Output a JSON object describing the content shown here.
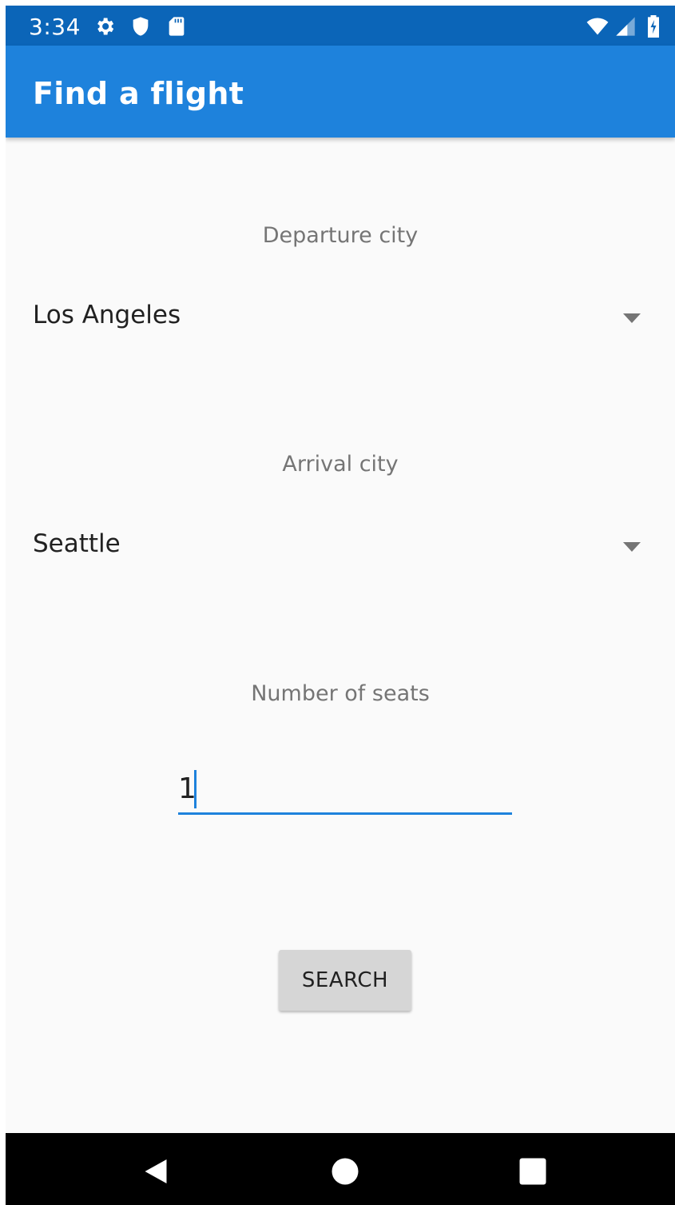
{
  "status_bar": {
    "time": "3:34",
    "icons": [
      "gear-icon",
      "shield-icon",
      "sd-card-icon",
      "wifi-icon",
      "cellular-signal-icon",
      "battery-charging-icon"
    ]
  },
  "app_bar": {
    "title": "Find a flight"
  },
  "form": {
    "departure_label": "Departure city",
    "departure_value": "Los Angeles",
    "arrival_label": "Arrival city",
    "arrival_value": "Seattle",
    "seats_label": "Number of seats",
    "seats_value": "1",
    "search_label": "SEARCH"
  },
  "nav_bar": {
    "buttons": [
      "back-icon",
      "home-icon",
      "recents-icon"
    ]
  },
  "colors": {
    "status_bar": "#0b65b8",
    "app_bar": "#1e82dc",
    "accent": "#1e82dc",
    "background": "#fafafa",
    "button": "#d6d6d6"
  }
}
